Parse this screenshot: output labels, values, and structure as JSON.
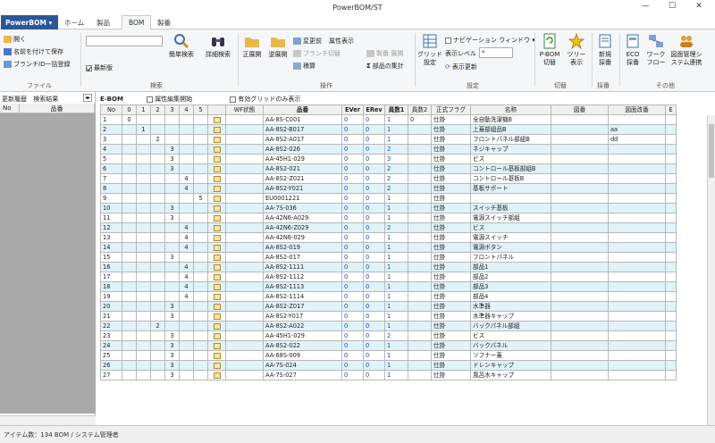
{
  "window": {
    "title": "PowerBOM/ST",
    "minimize": "—",
    "maximize": "☐",
    "close": "✕"
  },
  "tabs": {
    "app_menu": "PowerBOM ▾",
    "items": [
      "ホーム",
      "製品",
      "BOM",
      "製番"
    ]
  },
  "ribbon": {
    "file": {
      "open": "開く",
      "save_as": "名前を付けて保存",
      "branch": "ブランチID一括登録",
      "group": "ファイル"
    },
    "search": {
      "placeholder": "",
      "latest": "最新版",
      "simple": "簡単検索",
      "detail": "詳細検索",
      "group": "検索"
    },
    "operation": {
      "forward": "正展開",
      "reverse": "逆展開",
      "before_change": "変更前",
      "attr_display": "属性表示",
      "branch_switch": "ブランチ切替",
      "total": "積算",
      "delete_product": "製番",
      "expand": "展開",
      "parts_total": "部品の集計",
      "group": "操作"
    },
    "settings": {
      "grid": "グリッド",
      "grid2": "設定",
      "nav_window": "ナビゲーション ウィンドウ ▾",
      "display_level": "表示レベル",
      "level_value": "*",
      "refresh": "表示更新",
      "group": "設定"
    },
    "switch": {
      "pbom1": "P-BOM",
      "pbom2": "切替",
      "tree1": "ツリー",
      "tree2": "表示",
      "group": "切替"
    },
    "register": {
      "new1": "新規",
      "new2": "採番",
      "group": "採番"
    },
    "other": {
      "eco1": "ECO",
      "eco2": "採番",
      "wf1": "ワーク",
      "wf2": "フロー",
      "sys1": "図面管理シ",
      "sys2": "ステム連携",
      "group": "その他"
    }
  },
  "left": {
    "tab1": "更新履歴",
    "tab2": "検索結果",
    "col_no": "No",
    "col_part": "品番"
  },
  "main": {
    "label": "E-BOM",
    "attr_edit": "属性編集開始",
    "valid_grid": "有効グリッドのみ表示"
  },
  "columns": [
    "No",
    "0",
    "1",
    "2",
    "3",
    "4",
    "5",
    "",
    "WF状態",
    "品番",
    "EVer",
    "ERev",
    "員数1",
    "員数2",
    "正式フラグ",
    "名称",
    "図番",
    "図面改番",
    "E"
  ],
  "rows": [
    {
      "no": "1",
      "lv": 0,
      "part": "AA-8S-C001",
      "ever": "0",
      "erev": "0",
      "q1": "1",
      "q2": "0",
      "flag": "仕掛",
      "name": "全自動洗濯機B",
      "extra": ""
    },
    {
      "no": "2",
      "lv": 1,
      "part": "AA-8S2-B017",
      "ever": "0",
      "erev": "0",
      "q1": "1",
      "q2": "",
      "flag": "仕掛",
      "name": "上蓋部組品B",
      "extra": "aa"
    },
    {
      "no": "3",
      "lv": 2,
      "part": "AA-8S2-A017",
      "ever": "0",
      "erev": "0",
      "q1": "1",
      "q2": "",
      "flag": "仕掛",
      "name": "フロントパネル部組B",
      "extra": "dd"
    },
    {
      "no": "4",
      "lv": 3,
      "part": "AA-8S2-026",
      "ever": "0",
      "erev": "0",
      "q1": "2",
      "q2": "",
      "flag": "仕掛",
      "name": "ネジキャップ",
      "extra": ""
    },
    {
      "no": "5",
      "lv": 3,
      "part": "AA-45H1-029",
      "ever": "0",
      "erev": "0",
      "q1": "3",
      "q2": "",
      "flag": "仕掛",
      "name": "ビス",
      "extra": ""
    },
    {
      "no": "6",
      "lv": 3,
      "part": "AA-8S2-021",
      "ever": "0",
      "erev": "0",
      "q1": "2",
      "q2": "",
      "flag": "仕掛",
      "name": "コントロール基板部組B",
      "extra": ""
    },
    {
      "no": "7",
      "lv": 4,
      "part": "AA-8S2-Z021",
      "ever": "0",
      "erev": "0",
      "q1": "2",
      "q2": "",
      "flag": "仕掛",
      "name": "コントロール基板B",
      "extra": ""
    },
    {
      "no": "8",
      "lv": 4,
      "part": "AA-8S2-Y021",
      "ever": "0",
      "erev": "0",
      "q1": "2",
      "q2": "",
      "flag": "仕掛",
      "name": "基板サポート",
      "extra": ""
    },
    {
      "no": "9",
      "lv": 5,
      "part": "EU0001221",
      "ever": "0",
      "erev": "0",
      "q1": "1",
      "q2": "",
      "flag": "仕掛",
      "name": "",
      "extra": ""
    },
    {
      "no": "10",
      "lv": 3,
      "part": "AA-7S-036",
      "ever": "0",
      "erev": "0",
      "q1": "1",
      "q2": "",
      "flag": "仕掛",
      "name": "スイッチ基板",
      "extra": ""
    },
    {
      "no": "11",
      "lv": 3,
      "part": "AA-42N6-A029",
      "ever": "0",
      "erev": "0",
      "q1": "1",
      "q2": "",
      "flag": "仕掛",
      "name": "電源スイッチ部組",
      "extra": ""
    },
    {
      "no": "12",
      "lv": 4,
      "part": "AA-42N6-Z029",
      "ever": "0",
      "erev": "0",
      "q1": "2",
      "q2": "",
      "flag": "仕掛",
      "name": "ビス",
      "extra": ""
    },
    {
      "no": "13",
      "lv": 4,
      "part": "AA-42N6-029",
      "ever": "0",
      "erev": "0",
      "q1": "1",
      "q2": "",
      "flag": "仕掛",
      "name": "電源スイッチ",
      "extra": ""
    },
    {
      "no": "14",
      "lv": 4,
      "part": "AA-8S2-019",
      "ever": "0",
      "erev": "0",
      "q1": "1",
      "q2": "",
      "flag": "仕掛",
      "name": "電源ボタン",
      "extra": ""
    },
    {
      "no": "15",
      "lv": 3,
      "part": "AA-8S2-017",
      "ever": "0",
      "erev": "0",
      "q1": "1",
      "q2": "",
      "flag": "仕掛",
      "name": "フロントパネル",
      "extra": ""
    },
    {
      "no": "16",
      "lv": 4,
      "part": "AA-8S2-1111",
      "ever": "0",
      "erev": "0",
      "q1": "1",
      "q2": "",
      "flag": "仕掛",
      "name": "部品1",
      "extra": ""
    },
    {
      "no": "17",
      "lv": 4,
      "part": "AA-8S2-1112",
      "ever": "0",
      "erev": "0",
      "q1": "1",
      "q2": "",
      "flag": "仕掛",
      "name": "部品2",
      "extra": ""
    },
    {
      "no": "18",
      "lv": 4,
      "part": "AA-8S2-1113",
      "ever": "0",
      "erev": "0",
      "q1": "1",
      "q2": "",
      "flag": "仕掛",
      "name": "部品3",
      "extra": ""
    },
    {
      "no": "19",
      "lv": 4,
      "part": "AA-8S2-1114",
      "ever": "0",
      "erev": "0",
      "q1": "1",
      "q2": "",
      "flag": "仕掛",
      "name": "部品4",
      "extra": ""
    },
    {
      "no": "20",
      "lv": 3,
      "part": "AA-8S2-Z017",
      "ever": "0",
      "erev": "0",
      "q1": "1",
      "q2": "",
      "flag": "仕掛",
      "name": "水準器",
      "extra": ""
    },
    {
      "no": "21",
      "lv": 3,
      "part": "AA-8S2-Y017",
      "ever": "0",
      "erev": "0",
      "q1": "1",
      "q2": "",
      "flag": "仕掛",
      "name": "水準器キャップ",
      "extra": ""
    },
    {
      "no": "22",
      "lv": 2,
      "part": "AA-8S2-A022",
      "ever": "0",
      "erev": "0",
      "q1": "1",
      "q2": "",
      "flag": "仕掛",
      "name": "バックパネル部組",
      "extra": ""
    },
    {
      "no": "23",
      "lv": 3,
      "part": "AA-45H1-029",
      "ever": "0",
      "erev": "0",
      "q1": "2",
      "q2": "",
      "flag": "仕掛",
      "name": "ビス",
      "extra": ""
    },
    {
      "no": "24",
      "lv": 3,
      "part": "AA-8S2-022",
      "ever": "0",
      "erev": "0",
      "q1": "1",
      "q2": "",
      "flag": "仕掛",
      "name": "バックパネル",
      "extra": ""
    },
    {
      "no": "25",
      "lv": 3,
      "part": "AA-68S-009",
      "ever": "0",
      "erev": "0",
      "q1": "1",
      "q2": "",
      "flag": "仕掛",
      "name": "ソフナー蓋",
      "extra": ""
    },
    {
      "no": "26",
      "lv": 3,
      "part": "AA-7S-024",
      "ever": "0",
      "erev": "0",
      "q1": "1",
      "q2": "",
      "flag": "仕掛",
      "name": "ドレンキャップ",
      "extra": ""
    },
    {
      "no": "27",
      "lv": 3,
      "part": "AA-7S-027",
      "ever": "0",
      "erev": "0",
      "q1": "1",
      "q2": "",
      "flag": "仕掛",
      "name": "風呂水キャップ",
      "extra": ""
    }
  ],
  "status": {
    "text": "アイテム数：134  BOM / システム管理者"
  },
  "colors": {
    "accent": "#2b5797",
    "row_alt": "#dff3f8",
    "version_blue": "#1a3cd6"
  }
}
